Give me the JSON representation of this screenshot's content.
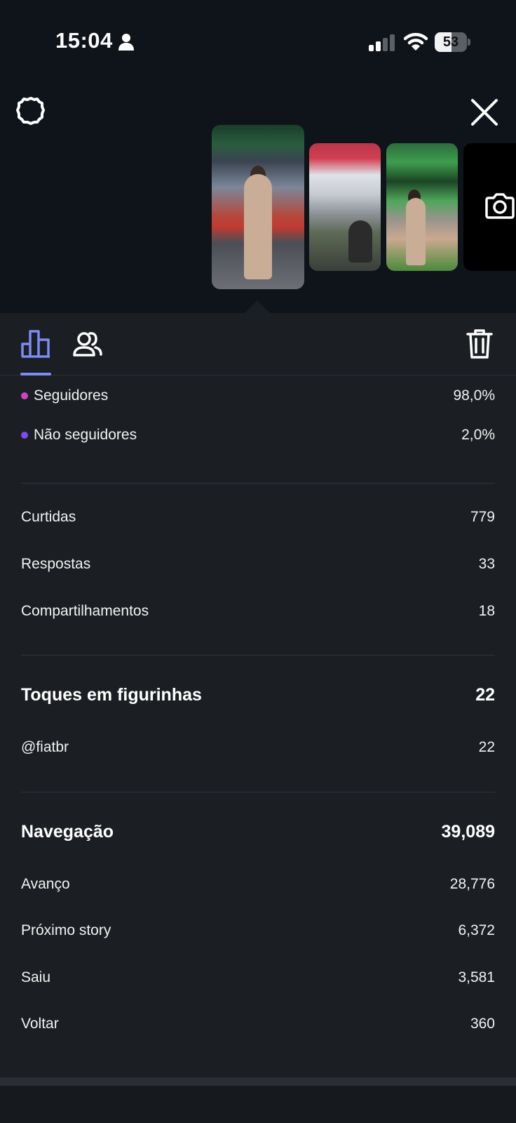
{
  "status_bar": {
    "time": "15:04",
    "battery": "53",
    "battery_level": 0.53,
    "icons": [
      "person-icon",
      "signal-icon",
      "wifi-icon",
      "battery-icon"
    ]
  },
  "header": {
    "icons": [
      "gear-icon",
      "close-icon",
      "camera-icon"
    ]
  },
  "thumbnails": {
    "count_shown": 4,
    "selected_index": 0
  },
  "tabs": {
    "icons": [
      "bar-chart-icon",
      "people-icon",
      "trash-icon"
    ],
    "active": "bar-chart-icon",
    "accent_color": "#7b8cf7"
  },
  "audience": [
    {
      "label": "Seguidores",
      "value": "98,0%",
      "dot_color": "#d142c9"
    },
    {
      "label": "Não seguidores",
      "value": "2,0%",
      "dot_color": "#7a4cf2"
    }
  ],
  "interactions": [
    {
      "label": "Curtidas",
      "value": "779"
    },
    {
      "label": "Respostas",
      "value": "33"
    },
    {
      "label": "Compartilhamentos",
      "value": "18"
    }
  ],
  "sticker_taps": {
    "title": "Toques em figurinhas",
    "total": "22",
    "items": [
      {
        "label": "@fiatbr",
        "value": "22"
      }
    ]
  },
  "navigation": {
    "title": "Navegação",
    "total": "39,089",
    "items": [
      {
        "label": "Avanço",
        "value": "28,776"
      },
      {
        "label": "Próximo story",
        "value": "6,372"
      },
      {
        "label": "Saiu",
        "value": "3,581"
      },
      {
        "label": "Voltar",
        "value": "360"
      }
    ]
  }
}
